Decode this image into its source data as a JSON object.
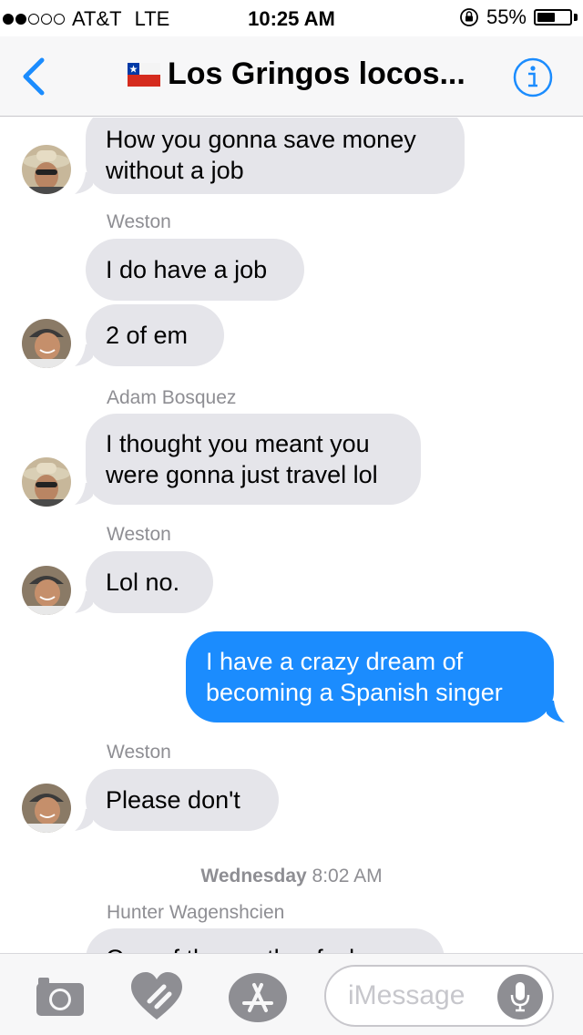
{
  "status_bar": {
    "carrier": "AT&T",
    "network": "LTE",
    "time": "10:25 AM",
    "battery": "55%",
    "battery_level": 0.55,
    "signal_bars_filled": 2,
    "signal_bars_total": 5
  },
  "nav": {
    "back_icon": "chevron-left-icon",
    "flag_icon": "chile-flag-icon",
    "title": "Los Gringos locos...",
    "info_icon": "info-icon",
    "accent_color": "#1b8cfe"
  },
  "messages": [
    {
      "type": "bubble",
      "direction": "in",
      "text": "How you gonna save money\nwithout a job",
      "avatar": "hat-sunglasses"
    },
    {
      "type": "sender",
      "text": "Weston"
    },
    {
      "type": "bubble",
      "direction": "in",
      "text": "I do have a job"
    },
    {
      "type": "bubble",
      "direction": "in",
      "text": "2 of em",
      "avatar": "smiling-cap"
    },
    {
      "type": "sender",
      "text": "Adam Bosquez"
    },
    {
      "type": "bubble",
      "direction": "in",
      "text": "I thought you meant you\nwere gonna just travel lol",
      "avatar": "hat-sunglasses"
    },
    {
      "type": "sender",
      "text": "Weston"
    },
    {
      "type": "bubble",
      "direction": "in",
      "text": "Lol no.",
      "avatar": "smiling-cap"
    },
    {
      "type": "bubble",
      "direction": "out",
      "text": "I have a crazy dream of\nbecoming a Spanish singer"
    },
    {
      "type": "sender",
      "text": "Weston"
    },
    {
      "type": "bubble",
      "direction": "in",
      "text": "Please don't",
      "avatar": "smiling-cap"
    },
    {
      "type": "timestamp",
      "day": "Wednesday",
      "time": "8:02 AM"
    },
    {
      "type": "sender",
      "text": "Hunter Wagenshcien"
    },
    {
      "type": "bubble",
      "direction": "in",
      "text": "One of these other fuck...",
      "partial": true
    }
  ],
  "colors": {
    "incoming_bubble": "#e5e5ea",
    "outgoing_bubble": "#1b8cfe",
    "meta_text": "#8e8e93"
  },
  "input_bar": {
    "camera_icon": "camera-icon",
    "heart_icon": "digital-touch-heart-icon",
    "appstore_icon": "app-store-icon",
    "placeholder": "iMessage",
    "mic_icon": "microphone-icon"
  }
}
